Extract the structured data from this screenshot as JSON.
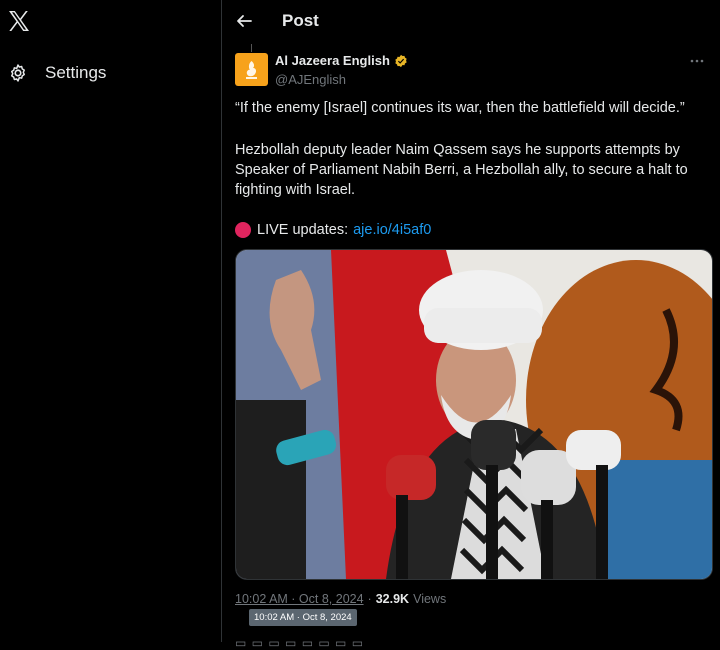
{
  "sidebar": {
    "settings_label": "Settings"
  },
  "header": {
    "title": "Post"
  },
  "tweet": {
    "author_name": "Al Jazeera English",
    "author_handle": "@AJEnglish",
    "quote": "“If the enemy [Israel] continues its war, then the battlefield will decide.”",
    "body": "Hezbollah deputy leader Naim Qassem says he supports attempts by Speaker of Parliament Nabih Berri, a Hezbollah ally, to secure a halt to fighting with Israel.",
    "live_label": "LIVE updates:",
    "live_link": "aje.io/4i5af0",
    "timestamp": "10:02 AM · Oct 8, 2024",
    "separator": "·",
    "views_count": "32.9K",
    "views_label": "Views",
    "tooltip": "10:02 AM · Oct 8, 2024"
  },
  "colors": {
    "accent": "#1d9bf0",
    "live_dot": "#e0245e",
    "avatar_bg": "#f7a21b",
    "background": "#000000"
  },
  "icons": [
    "x-logo-icon",
    "gear-icon",
    "back-arrow-icon",
    "verified-badge-icon",
    "more-icon",
    "live-dot-icon"
  ]
}
